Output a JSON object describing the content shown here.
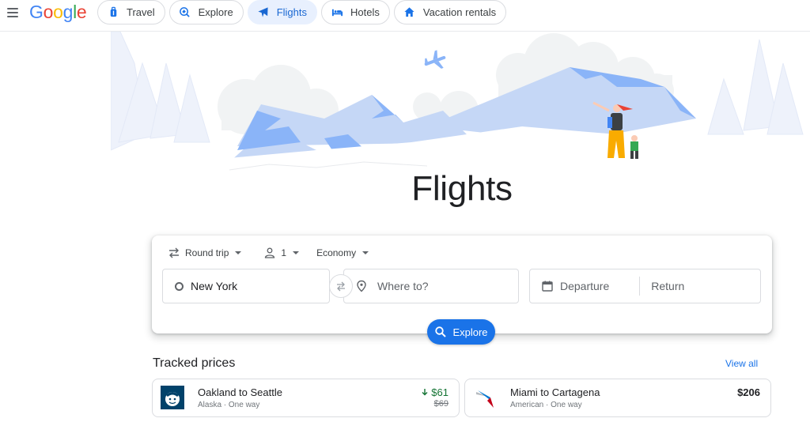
{
  "header": {
    "logo_letters": [
      "G",
      "o",
      "o",
      "g",
      "l",
      "e"
    ],
    "logo_colors": [
      "#4285f4",
      "#ea4335",
      "#fbbc05",
      "#4285f4",
      "#34a853",
      "#ea4335"
    ],
    "nav": [
      {
        "label": "Travel",
        "icon": "luggage-icon",
        "active": false
      },
      {
        "label": "Explore",
        "icon": "explore-icon",
        "active": false
      },
      {
        "label": "Flights",
        "icon": "flight-icon",
        "active": true
      },
      {
        "label": "Hotels",
        "icon": "bed-icon",
        "active": false
      },
      {
        "label": "Vacation rentals",
        "icon": "home-icon",
        "active": false
      }
    ]
  },
  "hero": {
    "title": "Flights"
  },
  "search": {
    "trip_type": "Round trip",
    "passengers": "1",
    "cabin_class": "Economy",
    "origin": "New York",
    "destination_placeholder": "Where to?",
    "departure_placeholder": "Departure",
    "return_placeholder": "Return",
    "explore_label": "Explore"
  },
  "tracked": {
    "title": "Tracked prices",
    "view_all": "View all",
    "items": [
      {
        "route": "Oakland to Seattle",
        "airline": "Alaska",
        "trip": "One way",
        "price": "$61",
        "old_price": "$69",
        "dropped": true
      },
      {
        "route": "Miami to Cartagena",
        "airline": "American",
        "trip": "One way",
        "price": "$206",
        "dropped": false
      }
    ]
  },
  "colors": {
    "accent": "#1a73e8",
    "active_chip_bg": "#e8f0fe",
    "price_drop": "#137333"
  }
}
